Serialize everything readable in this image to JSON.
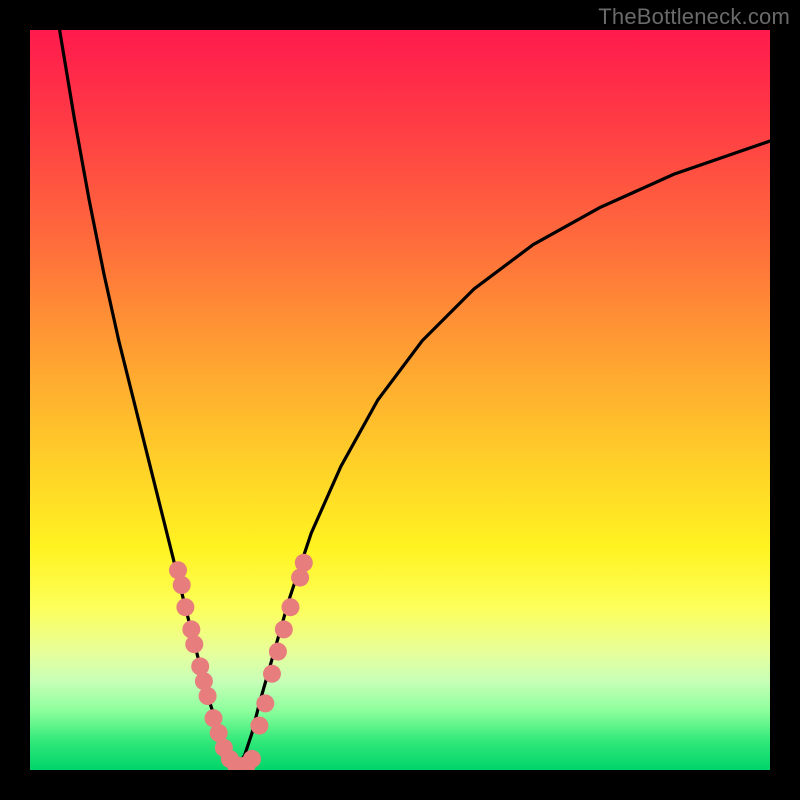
{
  "watermark": "TheBottleneck.com",
  "chart_data": {
    "type": "line",
    "title": "",
    "xlabel": "",
    "ylabel": "",
    "xlim": [
      0,
      100
    ],
    "ylim": [
      0,
      100
    ],
    "series": [
      {
        "name": "left-curve",
        "x": [
          4,
          6,
          8,
          10,
          12,
          14,
          16,
          18,
          20,
          21,
          22,
          23,
          24,
          25,
          26,
          27,
          28
        ],
        "y": [
          100,
          88,
          77,
          67,
          58,
          50,
          42,
          34,
          26,
          22,
          18,
          14,
          10,
          7,
          4,
          2,
          0.5
        ]
      },
      {
        "name": "right-curve",
        "x": [
          28,
          29,
          30,
          31,
          33,
          35,
          38,
          42,
          47,
          53,
          60,
          68,
          77,
          87,
          100
        ],
        "y": [
          0.5,
          2,
          5,
          9,
          16,
          23,
          32,
          41,
          50,
          58,
          65,
          71,
          76,
          80.5,
          85
        ]
      }
    ],
    "scatter": [
      {
        "name": "left-dots",
        "color": "#e77d7d",
        "points": [
          {
            "x": 20.0,
            "y": 27
          },
          {
            "x": 20.5,
            "y": 25
          },
          {
            "x": 21.0,
            "y": 22
          },
          {
            "x": 21.8,
            "y": 19
          },
          {
            "x": 22.2,
            "y": 17
          },
          {
            "x": 23.0,
            "y": 14
          },
          {
            "x": 23.5,
            "y": 12
          },
          {
            "x": 24.0,
            "y": 10
          },
          {
            "x": 24.8,
            "y": 7
          },
          {
            "x": 25.5,
            "y": 5
          },
          {
            "x": 26.2,
            "y": 3
          },
          {
            "x": 27.0,
            "y": 1.5
          },
          {
            "x": 27.8,
            "y": 0.7
          },
          {
            "x": 28.5,
            "y": 0.5
          },
          {
            "x": 29.3,
            "y": 0.7
          },
          {
            "x": 30.0,
            "y": 1.5
          }
        ]
      },
      {
        "name": "right-dots",
        "color": "#e77d7d",
        "points": [
          {
            "x": 31.0,
            "y": 6
          },
          {
            "x": 31.8,
            "y": 9
          },
          {
            "x": 32.7,
            "y": 13
          },
          {
            "x": 33.5,
            "y": 16
          },
          {
            "x": 34.3,
            "y": 19
          },
          {
            "x": 35.2,
            "y": 22
          },
          {
            "x": 36.5,
            "y": 26
          },
          {
            "x": 37.0,
            "y": 28
          }
        ]
      }
    ]
  }
}
